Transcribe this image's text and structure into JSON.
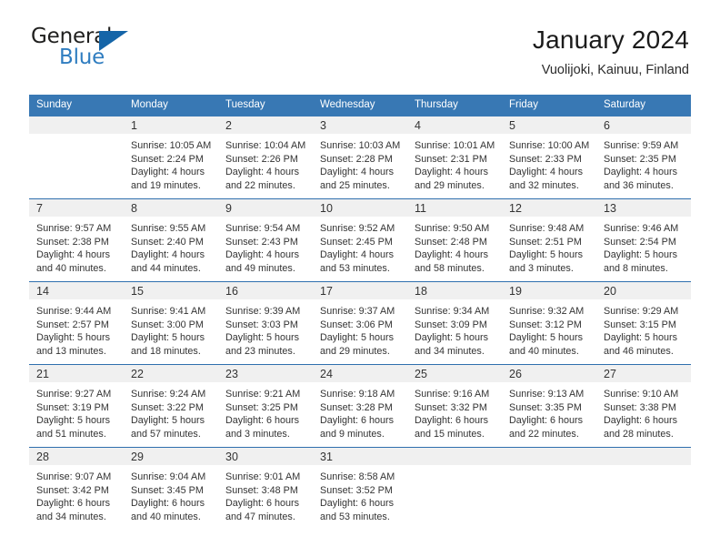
{
  "brand": {
    "name_top": "General",
    "name_bottom": "Blue",
    "triangle_icon": "blue-triangle-logo-mark",
    "color_dark": "#20201f",
    "color_blue": "#2f7dc0",
    "color_triangle": "#1565a8"
  },
  "header": {
    "title": "January 2024",
    "subtitle": "Vuolijoki, Kainuu, Finland"
  },
  "theme": {
    "header_row_bg": "#3878b4",
    "header_row_text": "#ffffff",
    "daynum_bg": "#f0f0f0",
    "row_divider": "#2f6fae",
    "cell_bg": "#ffffff",
    "body_text": "#333333"
  },
  "weekday_headers": [
    "Sunday",
    "Monday",
    "Tuesday",
    "Wednesday",
    "Thursday",
    "Friday",
    "Saturday"
  ],
  "weeks": [
    [
      {
        "day": "",
        "lines": []
      },
      {
        "day": "1",
        "lines": [
          "Sunrise: 10:05 AM",
          "Sunset: 2:24 PM",
          "Daylight: 4 hours",
          "and 19 minutes."
        ]
      },
      {
        "day": "2",
        "lines": [
          "Sunrise: 10:04 AM",
          "Sunset: 2:26 PM",
          "Daylight: 4 hours",
          "and 22 minutes."
        ]
      },
      {
        "day": "3",
        "lines": [
          "Sunrise: 10:03 AM",
          "Sunset: 2:28 PM",
          "Daylight: 4 hours",
          "and 25 minutes."
        ]
      },
      {
        "day": "4",
        "lines": [
          "Sunrise: 10:01 AM",
          "Sunset: 2:31 PM",
          "Daylight: 4 hours",
          "and 29 minutes."
        ]
      },
      {
        "day": "5",
        "lines": [
          "Sunrise: 10:00 AM",
          "Sunset: 2:33 PM",
          "Daylight: 4 hours",
          "and 32 minutes."
        ]
      },
      {
        "day": "6",
        "lines": [
          "Sunrise: 9:59 AM",
          "Sunset: 2:35 PM",
          "Daylight: 4 hours",
          "and 36 minutes."
        ]
      }
    ],
    [
      {
        "day": "7",
        "lines": [
          "Sunrise: 9:57 AM",
          "Sunset: 2:38 PM",
          "Daylight: 4 hours",
          "and 40 minutes."
        ]
      },
      {
        "day": "8",
        "lines": [
          "Sunrise: 9:55 AM",
          "Sunset: 2:40 PM",
          "Daylight: 4 hours",
          "and 44 minutes."
        ]
      },
      {
        "day": "9",
        "lines": [
          "Sunrise: 9:54 AM",
          "Sunset: 2:43 PM",
          "Daylight: 4 hours",
          "and 49 minutes."
        ]
      },
      {
        "day": "10",
        "lines": [
          "Sunrise: 9:52 AM",
          "Sunset: 2:45 PM",
          "Daylight: 4 hours",
          "and 53 minutes."
        ]
      },
      {
        "day": "11",
        "lines": [
          "Sunrise: 9:50 AM",
          "Sunset: 2:48 PM",
          "Daylight: 4 hours",
          "and 58 minutes."
        ]
      },
      {
        "day": "12",
        "lines": [
          "Sunrise: 9:48 AM",
          "Sunset: 2:51 PM",
          "Daylight: 5 hours",
          "and 3 minutes."
        ]
      },
      {
        "day": "13",
        "lines": [
          "Sunrise: 9:46 AM",
          "Sunset: 2:54 PM",
          "Daylight: 5 hours",
          "and 8 minutes."
        ]
      }
    ],
    [
      {
        "day": "14",
        "lines": [
          "Sunrise: 9:44 AM",
          "Sunset: 2:57 PM",
          "Daylight: 5 hours",
          "and 13 minutes."
        ]
      },
      {
        "day": "15",
        "lines": [
          "Sunrise: 9:41 AM",
          "Sunset: 3:00 PM",
          "Daylight: 5 hours",
          "and 18 minutes."
        ]
      },
      {
        "day": "16",
        "lines": [
          "Sunrise: 9:39 AM",
          "Sunset: 3:03 PM",
          "Daylight: 5 hours",
          "and 23 minutes."
        ]
      },
      {
        "day": "17",
        "lines": [
          "Sunrise: 9:37 AM",
          "Sunset: 3:06 PM",
          "Daylight: 5 hours",
          "and 29 minutes."
        ]
      },
      {
        "day": "18",
        "lines": [
          "Sunrise: 9:34 AM",
          "Sunset: 3:09 PM",
          "Daylight: 5 hours",
          "and 34 minutes."
        ]
      },
      {
        "day": "19",
        "lines": [
          "Sunrise: 9:32 AM",
          "Sunset: 3:12 PM",
          "Daylight: 5 hours",
          "and 40 minutes."
        ]
      },
      {
        "day": "20",
        "lines": [
          "Sunrise: 9:29 AM",
          "Sunset: 3:15 PM",
          "Daylight: 5 hours",
          "and 46 minutes."
        ]
      }
    ],
    [
      {
        "day": "21",
        "lines": [
          "Sunrise: 9:27 AM",
          "Sunset: 3:19 PM",
          "Daylight: 5 hours",
          "and 51 minutes."
        ]
      },
      {
        "day": "22",
        "lines": [
          "Sunrise: 9:24 AM",
          "Sunset: 3:22 PM",
          "Daylight: 5 hours",
          "and 57 minutes."
        ]
      },
      {
        "day": "23",
        "lines": [
          "Sunrise: 9:21 AM",
          "Sunset: 3:25 PM",
          "Daylight: 6 hours",
          "and 3 minutes."
        ]
      },
      {
        "day": "24",
        "lines": [
          "Sunrise: 9:18 AM",
          "Sunset: 3:28 PM",
          "Daylight: 6 hours",
          "and 9 minutes."
        ]
      },
      {
        "day": "25",
        "lines": [
          "Sunrise: 9:16 AM",
          "Sunset: 3:32 PM",
          "Daylight: 6 hours",
          "and 15 minutes."
        ]
      },
      {
        "day": "26",
        "lines": [
          "Sunrise: 9:13 AM",
          "Sunset: 3:35 PM",
          "Daylight: 6 hours",
          "and 22 minutes."
        ]
      },
      {
        "day": "27",
        "lines": [
          "Sunrise: 9:10 AM",
          "Sunset: 3:38 PM",
          "Daylight: 6 hours",
          "and 28 minutes."
        ]
      }
    ],
    [
      {
        "day": "28",
        "lines": [
          "Sunrise: 9:07 AM",
          "Sunset: 3:42 PM",
          "Daylight: 6 hours",
          "and 34 minutes."
        ]
      },
      {
        "day": "29",
        "lines": [
          "Sunrise: 9:04 AM",
          "Sunset: 3:45 PM",
          "Daylight: 6 hours",
          "and 40 minutes."
        ]
      },
      {
        "day": "30",
        "lines": [
          "Sunrise: 9:01 AM",
          "Sunset: 3:48 PM",
          "Daylight: 6 hours",
          "and 47 minutes."
        ]
      },
      {
        "day": "31",
        "lines": [
          "Sunrise: 8:58 AM",
          "Sunset: 3:52 PM",
          "Daylight: 6 hours",
          "and 53 minutes."
        ]
      },
      {
        "day": "",
        "lines": []
      },
      {
        "day": "",
        "lines": []
      },
      {
        "day": "",
        "lines": []
      }
    ]
  ]
}
